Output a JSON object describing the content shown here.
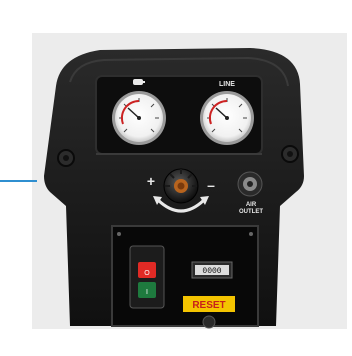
{
  "scene": {
    "description_colors": {
      "accent": "#2f8fd0",
      "panel_bg": "#ececec",
      "body": "#161616",
      "reset_bg": "#f4c400",
      "stop_red": "#e02a25",
      "start_green": "#1e7a3e"
    }
  },
  "labels": {
    "tank_gauge": "TANK",
    "line_gauge": "LINE",
    "air_outlet_line1": "AIR",
    "air_outlet_line2": "OUTLET",
    "plus": "+",
    "minus": "–",
    "reset": "RESET",
    "hour_counter": "0000"
  },
  "icons": {
    "tank": "tank-icon",
    "regulator": "regulator-knob",
    "arrow": "curved-arrow-icon"
  }
}
